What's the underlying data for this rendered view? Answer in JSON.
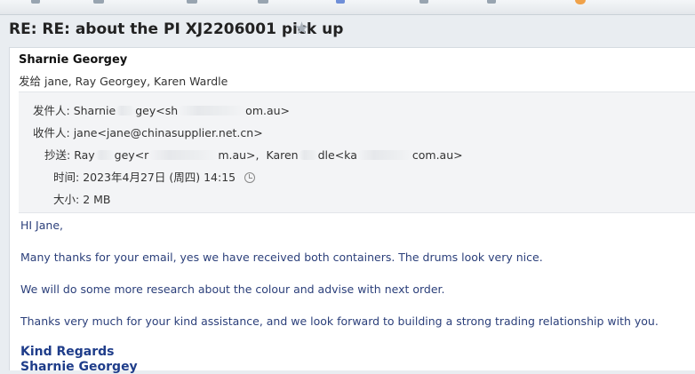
{
  "subject": "RE: RE: about the PI XJ2206001 pick up",
  "sender_name": "Sharnie Georgey",
  "send_to_line": "发给 jane, Ray Georgey, Karen Wardle",
  "meta": {
    "from_label": "发件人:",
    "from_name_part1": "Sharnie",
    "from_name_part2": "gey<sh",
    "from_email_tail": "om.au>",
    "to_label": "收件人:",
    "to_value": "jane<jane@chinasupplier.net.cn>",
    "cc_label": "抄送:",
    "cc_part1": "Ray",
    "cc_part2": "gey<r",
    "cc_part3": "m.au>,",
    "cc_part4": "Karen",
    "cc_part5": "dle<ka",
    "cc_part6": "com.au>",
    "time_label": "时间:",
    "time_value": "2023年4月27日 (周四) 14:15",
    "size_label": "大小:",
    "size_value": "2 MB"
  },
  "body": {
    "greeting": "HI Jane,",
    "para1": "Many thanks for your email, yes we have received both containers.  The drums look very nice.",
    "para2": "We will do some more research about the colour and advise with next order.",
    "para3": "Thanks very much for your kind assistance, and we look forward to building a strong trading relationship with you.",
    "regards": "Kind Regards",
    "signature_name": "Sharnie Georgey"
  },
  "colors": {
    "body_text": "#2b3f7a",
    "signoff": "#1f3d8a",
    "star": "#a9b1ba"
  }
}
